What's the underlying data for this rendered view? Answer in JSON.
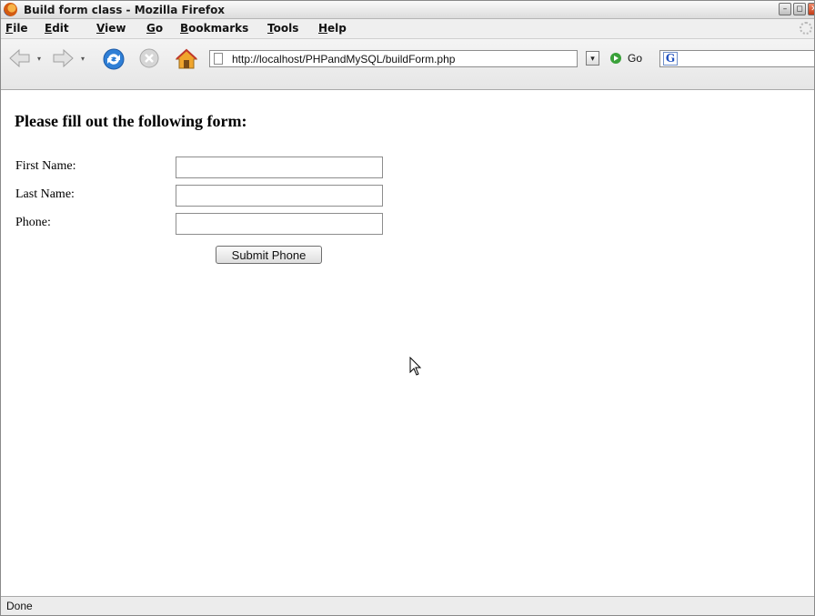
{
  "window": {
    "title": "Build form class - Mozilla Firefox",
    "buttons": {
      "minimize": "–",
      "maximize": "◻",
      "close": "✕"
    }
  },
  "menu": [
    {
      "id": "file",
      "label": "File"
    },
    {
      "id": "edit",
      "label": "Edit"
    },
    {
      "id": "view",
      "label": "View"
    },
    {
      "id": "go",
      "label": "Go"
    },
    {
      "id": "bookmarks",
      "label": "Bookmarks"
    },
    {
      "id": "tools",
      "label": "Tools"
    },
    {
      "id": "help",
      "label": "Help"
    }
  ],
  "toolbar": {
    "url": "http://localhost/PHPandMySQL/buildForm.php",
    "go_label": "Go",
    "search_engine": "G",
    "icons": [
      "back-icon",
      "forward-icon",
      "reload-icon",
      "stop-icon",
      "home-icon"
    ]
  },
  "page": {
    "heading": "Please fill out the following form:",
    "fields": [
      {
        "label": "First Name:",
        "value": ""
      },
      {
        "label": "Last Name:",
        "value": ""
      },
      {
        "label": "Phone:",
        "value": ""
      }
    ],
    "submit_label": "Submit Phone"
  },
  "status": {
    "text": "Done"
  },
  "colors": {
    "chrome_bg": "#efefef",
    "reload_blue": "#2f7fd6",
    "home_orange": "#f0a52d",
    "go_green": "#3aa13a"
  }
}
